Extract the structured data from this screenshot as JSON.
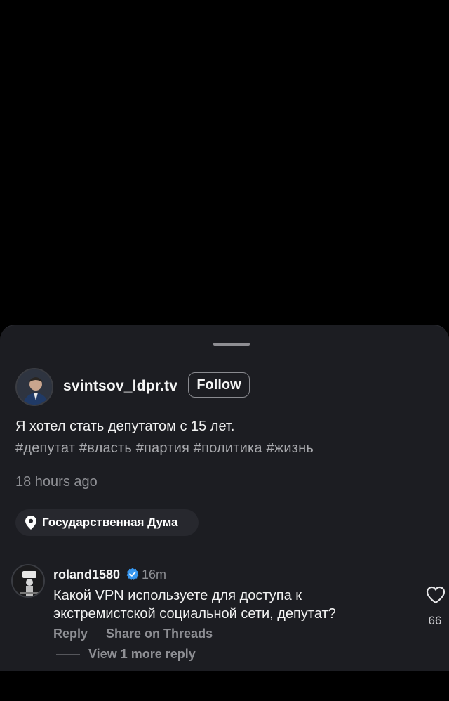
{
  "post": {
    "author": "svintsov_ldpr.tv",
    "follow_label": "Follow",
    "caption": "Я хотел стать депутатом с 15 лет.",
    "hashtags": "#депутат #власть #партия #политика #жизнь",
    "time_ago": "18 hours ago",
    "location": "Государственная Дума"
  },
  "comment": {
    "username": "roland1580",
    "verified": true,
    "time": "16m",
    "text_line1": "Какой VPN используете для доступа к",
    "text_line2": "экстремистской социальной сети, депутат?",
    "reply_label": "Reply",
    "share_label": "Share on Threads",
    "like_count": "66",
    "more_replies": "View 1 more reply"
  },
  "colors": {
    "sheet_background": "#1c1d22",
    "secondary_text": "#8e8f94",
    "verified_blue": "#3797f0"
  },
  "icons": {
    "location": "location-pin-icon",
    "verified": "verified-badge-icon",
    "like": "heart-outline-icon"
  }
}
